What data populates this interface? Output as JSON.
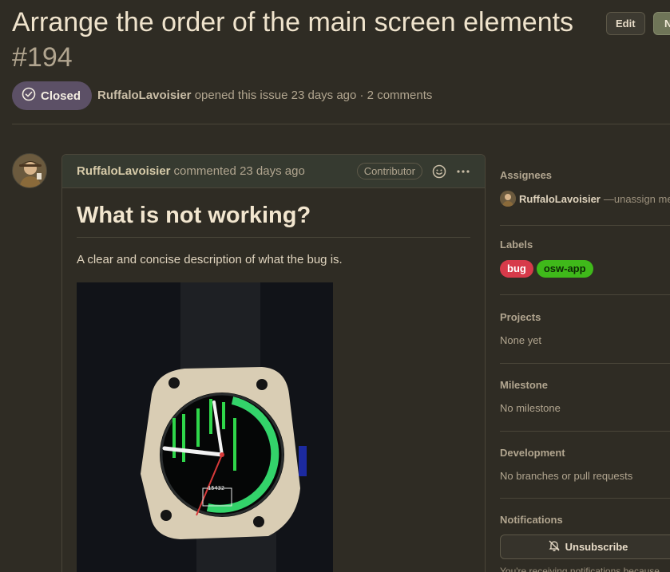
{
  "issue": {
    "title": "Arrange the order of the main screen elements",
    "number": "#194",
    "state": "Closed",
    "author": "RuffaloLavoisier",
    "meta_text": "opened this issue 23 days ago · 2 comments"
  },
  "header_buttons": {
    "edit": "Edit",
    "new": "N"
  },
  "comment": {
    "author": "RuffaloLavoisier",
    "action": "commented 23 days ago",
    "badge": "Contributor",
    "heading": "What is not working?",
    "body": "A clear and concise description of what the bug is.",
    "image_text": "15432"
  },
  "sidebar": {
    "assignees_title": "Assignees",
    "assignee_name": "RuffaloLavoisier",
    "assignee_rest": "—unassign me",
    "labels_title": "Labels",
    "labels": [
      {
        "name": "bug",
        "color": "#d73a4a"
      },
      {
        "name": "osw-app",
        "color": "#3fb91a"
      }
    ],
    "projects_title": "Projects",
    "projects_value": "None yet",
    "milestone_title": "Milestone",
    "milestone_value": "No milestone",
    "development_title": "Development",
    "development_value": "No branches or pull requests",
    "notifications_title": "Notifications",
    "unsubscribe_label": "Unsubscribe",
    "notifications_note": "You're receiving notifications because"
  },
  "icons": {
    "state": "check-circle-icon",
    "emoji": "smiley-icon",
    "more": "kebab-horizontal-icon",
    "unsubscribe": "bell-slash-icon"
  }
}
